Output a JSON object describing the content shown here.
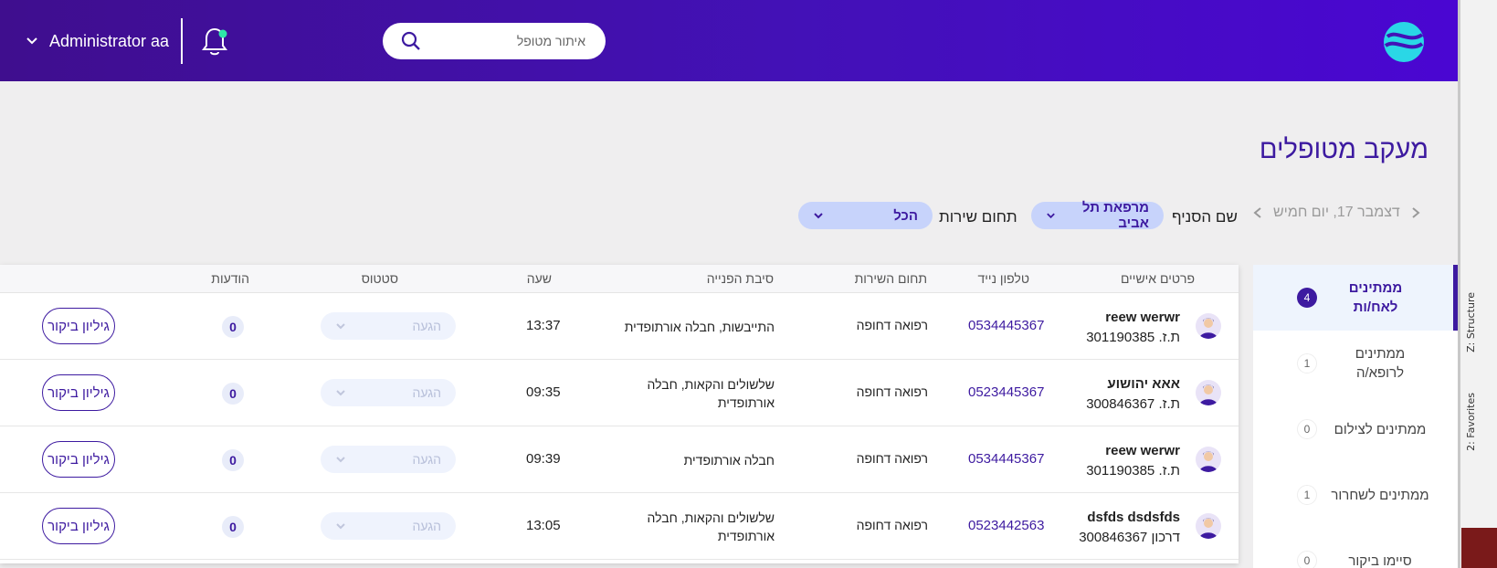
{
  "header": {
    "search_placeholder": "איתור מטופל",
    "user_name": "Administrator aa"
  },
  "page": {
    "title": "מעקב מטופלים"
  },
  "filters": {
    "date": "דצמבר 17, יום חמיש",
    "branch_label": "שם הסניף",
    "branch_value": "מרפאת תל אביב",
    "service_label": "תחום שירות",
    "service_value": "הכל"
  },
  "side_list": [
    {
      "label": "ממתינים לאח/ות",
      "count": "4",
      "active": true
    },
    {
      "label": "ממתינים לרופא/ה",
      "count": "1",
      "active": false
    },
    {
      "label": "ממתינים לצילום",
      "count": "0",
      "active": false
    },
    {
      "label": "ממתינים לשחרור",
      "count": "1",
      "active": false
    },
    {
      "label": "סיימו ביקור",
      "count": "0",
      "active": false
    }
  ],
  "table": {
    "headers": {
      "personal": "פרטים אישיים",
      "phone": "טלפון נייד",
      "service": "תחום השירות",
      "reason": "סיבת הפנייה",
      "time": "שעה",
      "status": "סטטוס",
      "messages": "הודעות"
    },
    "rows": [
      {
        "name": "reew werwr",
        "id": "ת.ז. 301190385",
        "phone": "0534445367",
        "service": "רפואה דחופה",
        "reason": "התייבשות, חבלה אורתופדית",
        "time": "13:37",
        "status": "הגעה",
        "messages": "0",
        "action": "גיליון ביקור"
      },
      {
        "name": "אאא יהושוע",
        "id": "ת.ז. 300846367",
        "phone": "0523445367",
        "service": "רפואה דחופה",
        "reason": "שלשולים והקאות, חבלה אורתופדית",
        "time": "09:35",
        "status": "הגעה",
        "messages": "0",
        "action": "גיליון ביקור"
      },
      {
        "name": "reew werwr",
        "id": "ת.ז. 301190385",
        "phone": "0534445367",
        "service": "רפואה דחופה",
        "reason": "חבלה אורתופדית",
        "time": "09:39",
        "status": "הגעה",
        "messages": "0",
        "action": "גיליון ביקור"
      },
      {
        "name": "dsfds dsdsfds",
        "id": "דרכון 300846367",
        "phone": "0523442563",
        "service": "רפואה דחופה",
        "reason": "שלשולים והקאות, חבלה אורתופדית",
        "time": "13:05",
        "status": "הגעה",
        "messages": "0",
        "action": "גיליון ביקור"
      }
    ]
  },
  "ide": {
    "tab_structure": "Z: Structure",
    "tab_favorites": "2: Favorites"
  },
  "colors": {
    "brand": "#3d1aa0",
    "header_start": "#3f0e8e",
    "header_end": "#4a06d2",
    "pill": "#c7d3fb"
  }
}
